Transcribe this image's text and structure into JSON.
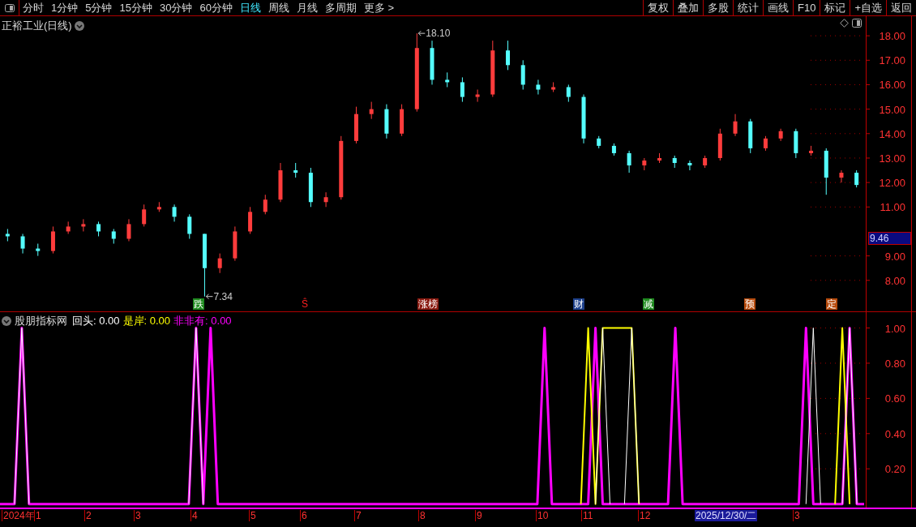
{
  "toolbar": {
    "periods": [
      {
        "label": "分时",
        "selected": false
      },
      {
        "label": "1分钟",
        "selected": false
      },
      {
        "label": "5分钟",
        "selected": false
      },
      {
        "label": "15分钟",
        "selected": false
      },
      {
        "label": "30分钟",
        "selected": false
      },
      {
        "label": "60分钟",
        "selected": false
      },
      {
        "label": "日线",
        "selected": true
      },
      {
        "label": "周线",
        "selected": false
      },
      {
        "label": "月线",
        "selected": false
      },
      {
        "label": "多周期",
        "selected": false
      }
    ],
    "more": "更多 >",
    "buttons": [
      "复权",
      "叠加",
      "多股",
      "统计",
      "画线",
      "F10",
      "标记",
      "+自选",
      "返回"
    ]
  },
  "price_panel": {
    "title": "正裕工业(日线)",
    "current_price": "9.46",
    "chart_data": {
      "type": "candlestick",
      "ohlc": [
        [
          9.9,
          10.1,
          9.6,
          9.8
        ],
        [
          9.8,
          9.9,
          9.1,
          9.3
        ],
        [
          9.3,
          9.5,
          9.0,
          9.2
        ],
        [
          9.2,
          10.2,
          9.1,
          10.0
        ],
        [
          10.0,
          10.4,
          9.9,
          10.2
        ],
        [
          10.2,
          10.5,
          10.0,
          10.3
        ],
        [
          10.3,
          10.4,
          9.8,
          10.0
        ],
        [
          10.0,
          10.1,
          9.5,
          9.7
        ],
        [
          9.7,
          10.5,
          9.6,
          10.3
        ],
        [
          10.3,
          11.1,
          10.2,
          10.9
        ],
        [
          10.9,
          11.2,
          10.8,
          11.0
        ],
        [
          11.0,
          11.1,
          10.4,
          10.6
        ],
        [
          10.6,
          10.7,
          9.7,
          9.9
        ],
        [
          9.9,
          9.9,
          7.34,
          8.5
        ],
        [
          8.5,
          9.1,
          8.3,
          8.9
        ],
        [
          8.9,
          10.2,
          8.8,
          10.0
        ],
        [
          10.0,
          11.0,
          9.9,
          10.8
        ],
        [
          10.8,
          11.5,
          10.7,
          11.3
        ],
        [
          11.3,
          12.8,
          11.2,
          12.5
        ],
        [
          12.5,
          12.8,
          12.2,
          12.4
        ],
        [
          12.4,
          12.6,
          11.0,
          11.2
        ],
        [
          11.2,
          11.6,
          11.0,
          11.4
        ],
        [
          11.4,
          13.9,
          11.3,
          13.7
        ],
        [
          13.7,
          15.1,
          13.6,
          14.8
        ],
        [
          14.8,
          15.3,
          14.6,
          15.0
        ],
        [
          15.0,
          15.2,
          13.8,
          14.0
        ],
        [
          14.0,
          15.2,
          13.9,
          15.0
        ],
        [
          15.0,
          18.1,
          14.9,
          17.5
        ],
        [
          17.5,
          17.8,
          16.0,
          16.2
        ],
        [
          16.2,
          16.5,
          15.9,
          16.1
        ],
        [
          16.1,
          16.3,
          15.3,
          15.5
        ],
        [
          15.5,
          15.8,
          15.3,
          15.6
        ],
        [
          15.6,
          17.8,
          15.5,
          17.4
        ],
        [
          17.4,
          17.8,
          16.6,
          16.8
        ],
        [
          16.8,
          17.0,
          15.8,
          16.0
        ],
        [
          16.0,
          16.2,
          15.6,
          15.8
        ],
        [
          15.8,
          16.1,
          15.7,
          15.9
        ],
        [
          15.9,
          16.0,
          15.3,
          15.5
        ],
        [
          15.5,
          15.6,
          13.6,
          13.8
        ],
        [
          13.8,
          13.9,
          13.4,
          13.5
        ],
        [
          13.5,
          13.6,
          13.1,
          13.2
        ],
        [
          13.2,
          13.3,
          12.4,
          12.7
        ],
        [
          12.7,
          13.0,
          12.5,
          12.9
        ],
        [
          12.9,
          13.2,
          12.8,
          13.0
        ],
        [
          13.0,
          13.1,
          12.6,
          12.8
        ],
        [
          12.8,
          12.9,
          12.5,
          12.7
        ],
        [
          12.7,
          13.1,
          12.6,
          13.0
        ],
        [
          13.0,
          14.2,
          12.9,
          14.0
        ],
        [
          14.0,
          14.8,
          13.9,
          14.5
        ],
        [
          14.5,
          14.6,
          13.2,
          13.4
        ],
        [
          13.4,
          13.9,
          13.3,
          13.8
        ],
        [
          13.8,
          14.2,
          13.7,
          14.1
        ],
        [
          14.1,
          14.2,
          13.0,
          13.2
        ],
        [
          13.2,
          13.5,
          13.1,
          13.3
        ],
        [
          13.3,
          13.4,
          11.5,
          12.2
        ],
        [
          12.2,
          12.5,
          12.0,
          12.4
        ],
        [
          12.4,
          12.5,
          11.8,
          11.9
        ]
      ],
      "ylim": [
        6.7,
        18.8
      ],
      "grid": true,
      "yticks": [
        {
          "value": 8,
          "label": "8.00"
        },
        {
          "value": 9,
          "label": "9.00"
        },
        {
          "value": 11,
          "label": "11.00"
        },
        {
          "value": 12,
          "label": "12.00"
        },
        {
          "value": 13,
          "label": "13.00"
        },
        {
          "value": 14,
          "label": "14.00"
        },
        {
          "value": 15,
          "label": "15.00"
        },
        {
          "value": 16,
          "label": "16.00"
        },
        {
          "value": 17,
          "label": "17.00"
        },
        {
          "value": 18,
          "label": "18.00"
        }
      ],
      "annotations": [
        "18.10",
        "7.34"
      ]
    },
    "events": [
      {
        "label": "跌",
        "kind": "box",
        "color": "#1f8a1f"
      },
      {
        "label": "Ŝ",
        "kind": "text",
        "color": "#ff2020"
      },
      {
        "label": "涨榜",
        "kind": "box",
        "color": "#8a1a10"
      },
      {
        "label": "财",
        "kind": "box",
        "color": "#1c3f8a"
      },
      {
        "label": "减",
        "kind": "box",
        "color": "#1f8a1f"
      },
      {
        "label": "预",
        "kind": "box",
        "color": "#b54a0c"
      },
      {
        "label": "定",
        "kind": "box",
        "color": "#b54a0c"
      }
    ]
  },
  "indicator_panel": {
    "name": "股朋指标网",
    "readings": [
      {
        "label": "回头:",
        "value": "0.00",
        "color": "#ffffff"
      },
      {
        "label": "是岸:",
        "value": "0.00",
        "color": "#ffff00"
      },
      {
        "label": "非非有:",
        "value": "0.00",
        "color": "#ff00ff"
      }
    ],
    "chart_data": {
      "type": "line",
      "ylim": [
        -0.02,
        1.09
      ],
      "grid": true,
      "yticks": [
        {
          "value": 0.2,
          "label": "0.20"
        },
        {
          "value": 0.4,
          "label": "0.40"
        },
        {
          "value": 0.6,
          "label": "0.60"
        },
        {
          "value": 0.8,
          "label": "0.80"
        },
        {
          "value": 1,
          "label": "1.00"
        }
      ],
      "series": [
        {
          "color": "#ffffff",
          "values": [
            null,
            null,
            0,
            1,
            0,
            null,
            null,
            null,
            null,
            null,
            null,
            null,
            null,
            null,
            null,
            null,
            null,
            null,
            null,
            null,
            null,
            null,
            null,
            null,
            null,
            null,
            0,
            1,
            0,
            null,
            null,
            null,
            null,
            null,
            null,
            null,
            null,
            null,
            null,
            null,
            null,
            null,
            null,
            null,
            null,
            null,
            null,
            null,
            null,
            null,
            null,
            null,
            null,
            null,
            null,
            null,
            null,
            null,
            null,
            null,
            null,
            null,
            null,
            null,
            null,
            null,
            null,
            null,
            null,
            null,
            null,
            null,
            null,
            null,
            null,
            null,
            null,
            null,
            null,
            null,
            null,
            null,
            0,
            1,
            0,
            null,
            0,
            1,
            0,
            null,
            null,
            null,
            null,
            null,
            null,
            null,
            null,
            null,
            null,
            null,
            null,
            null,
            null,
            null,
            null,
            null,
            null,
            null,
            null,
            null,
            null,
            0,
            1,
            0,
            null,
            null,
            0,
            1,
            0,
            null
          ]
        },
        {
          "color": "#ffff00",
          "values": [
            null,
            null,
            null,
            null,
            null,
            null,
            null,
            null,
            null,
            null,
            null,
            null,
            null,
            null,
            null,
            null,
            null,
            null,
            null,
            null,
            null,
            null,
            null,
            null,
            null,
            null,
            null,
            null,
            null,
            null,
            null,
            null,
            null,
            null,
            null,
            null,
            null,
            null,
            null,
            null,
            null,
            null,
            null,
            null,
            null,
            null,
            null,
            null,
            null,
            null,
            null,
            null,
            null,
            null,
            null,
            null,
            null,
            null,
            null,
            null,
            null,
            null,
            null,
            null,
            null,
            null,
            null,
            null,
            null,
            null,
            null,
            null,
            null,
            null,
            null,
            null,
            null,
            null,
            null,
            null,
            0,
            1,
            0,
            1,
            1,
            1,
            1,
            1,
            0,
            null,
            null,
            null,
            null,
            null,
            null,
            null,
            null,
            null,
            null,
            null,
            null,
            null,
            null,
            null,
            null,
            null,
            null,
            null,
            null,
            null,
            null,
            null,
            null,
            null,
            null,
            0,
            1,
            0,
            null,
            null
          ]
        },
        {
          "color": "#ff00ff",
          "values": [
            0,
            0,
            0,
            1,
            0,
            0,
            0,
            0,
            0,
            0,
            0,
            0,
            0,
            0,
            0,
            0,
            0,
            0,
            0,
            0,
            0,
            0,
            0,
            0,
            0,
            0,
            0,
            1,
            0,
            1,
            0,
            0,
            0,
            0,
            0,
            0,
            0,
            0,
            0,
            0,
            0,
            0,
            0,
            0,
            0,
            0,
            0,
            0,
            0,
            0,
            0,
            0,
            0,
            0,
            0,
            0,
            0,
            0,
            0,
            0,
            0,
            0,
            0,
            0,
            0,
            0,
            0,
            0,
            0,
            0,
            0,
            0,
            0,
            0,
            0,
            1,
            0,
            0,
            0,
            0,
            0,
            0,
            1,
            0,
            0,
            0,
            0,
            0,
            0,
            0,
            0,
            0,
            0,
            1,
            0,
            0,
            0,
            0,
            0,
            0,
            0,
            0,
            0,
            0,
            0,
            0,
            0,
            0,
            0,
            0,
            0,
            1,
            0,
            0,
            0,
            0,
            0,
            1,
            0,
            0
          ]
        }
      ]
    }
  },
  "time_axis": {
    "labels": [
      "2024年",
      "1",
      "2",
      "3",
      "4",
      "5",
      "6",
      "7",
      "8",
      "9",
      "10",
      "11",
      "12"
    ],
    "cursor_date": "2025/12/30/二",
    "cut_label": "3"
  }
}
